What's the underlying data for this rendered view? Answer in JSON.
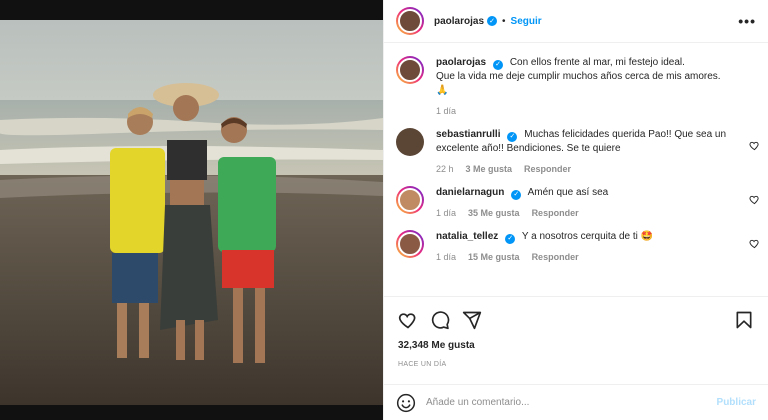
{
  "post": {
    "author": "paolarojas",
    "follow_label": "Seguir",
    "dot": "•",
    "more_label": "•••",
    "caption_line1": "Con ellos frente al mar, mi festejo ideal.",
    "caption_line2": "Que la vida me deje cumplir muchos años cerca de mis amores.",
    "caption_emoji": "🙏",
    "caption_time": "1 día",
    "verified_mark": "✓"
  },
  "comments": [
    {
      "user": "sebastianrulli",
      "text": "Muchas felicidades querida Pao!! Que sea un excelente año!! Bendiciones. Se te quiere",
      "time": "22 h",
      "likes": "3 Me gusta",
      "reply": "Responder"
    },
    {
      "user": "danielarnagun",
      "text": "Amén que así sea",
      "time": "1 día",
      "likes": "35 Me gusta",
      "reply": "Responder"
    },
    {
      "user": "natalia_tellez",
      "text": "Y a nosotros cerquita de ti 🤩",
      "time": "1 día",
      "likes": "15 Me gusta",
      "reply": "Responder"
    }
  ],
  "stats": {
    "likes": "32,348 Me gusta",
    "timestamp": "HACE UN DÍA"
  },
  "composer": {
    "placeholder": "Añade un comentario...",
    "publish_label": "Publicar"
  },
  "icons": {
    "like": "heart-icon",
    "comment": "comment-icon",
    "share": "share-icon",
    "save": "bookmark-icon",
    "emoji": "emoji-icon",
    "more": "more-icon"
  },
  "colors": {
    "accent": "#0095f6",
    "publish_disabled": "#b2dffc",
    "muted": "#8e8e8e"
  }
}
